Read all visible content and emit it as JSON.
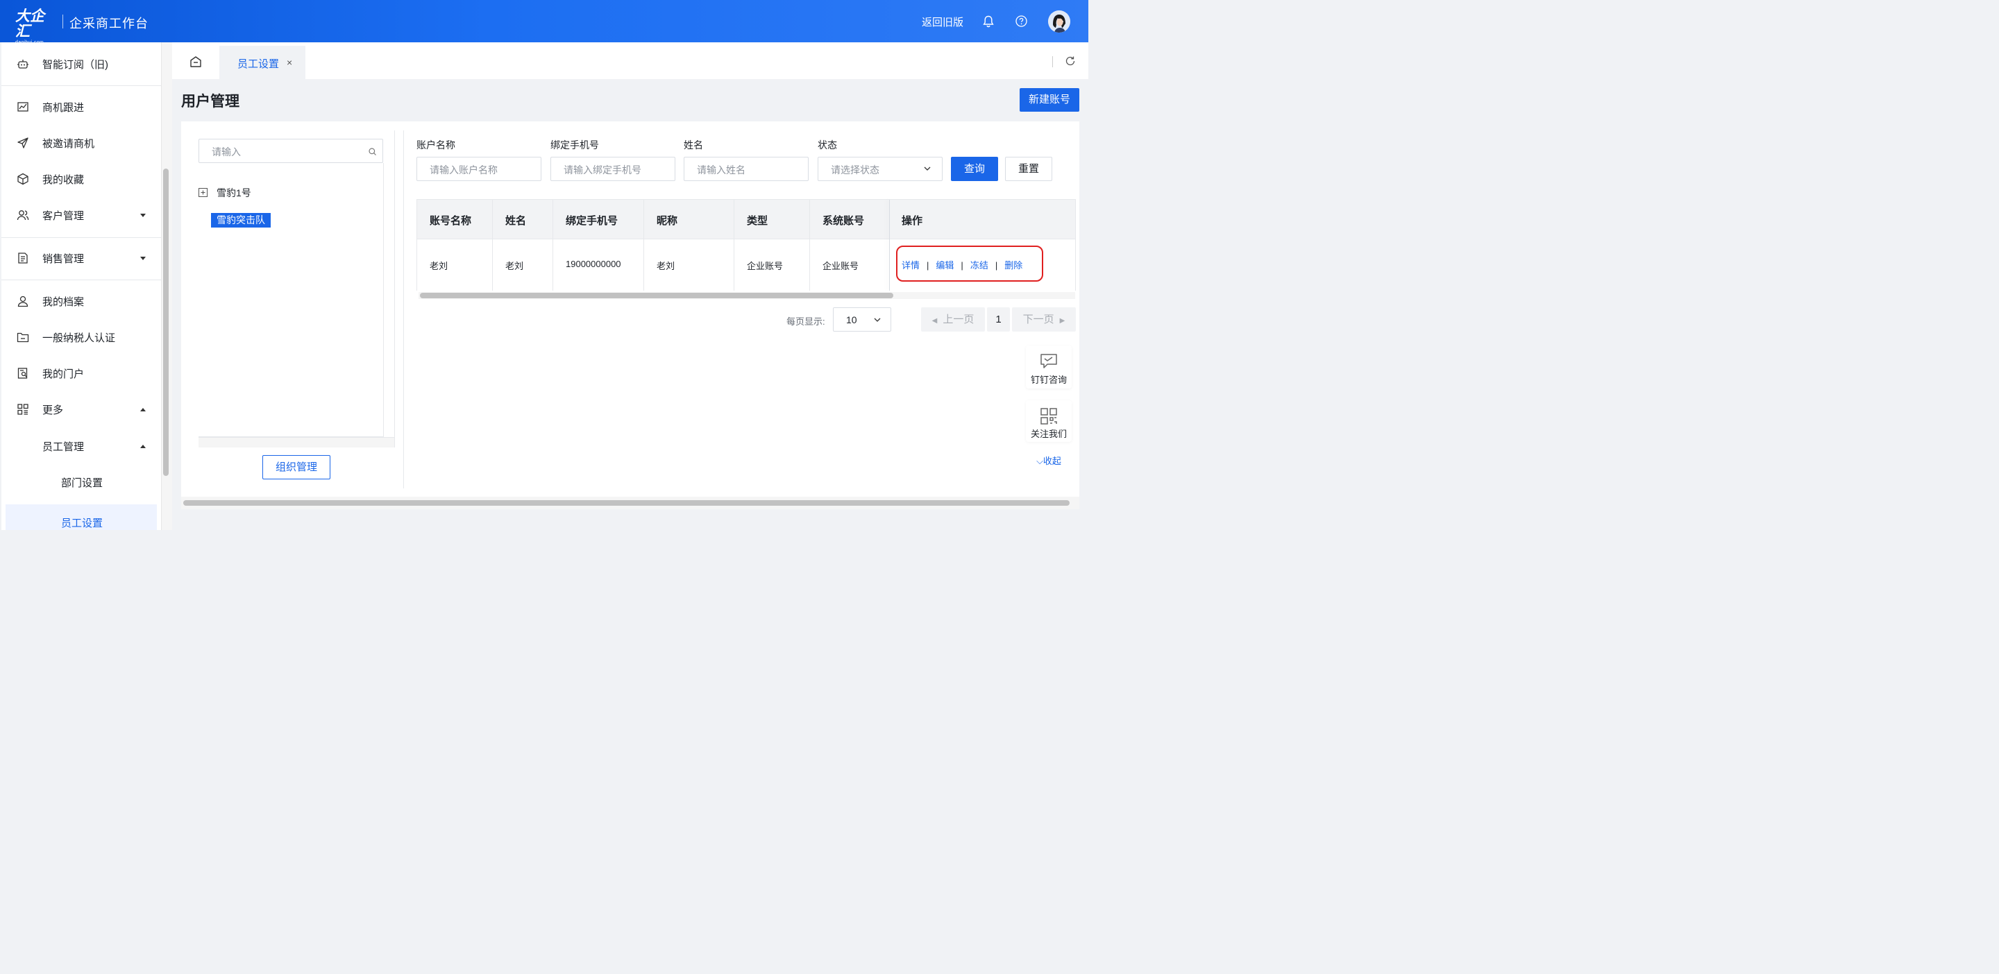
{
  "header": {
    "logo_main": "大企汇",
    "logo_sub": "daqihui.com",
    "app_title": "企采商工作台",
    "old_version_link": "返回旧版"
  },
  "sidebar": {
    "items": [
      {
        "label": "智能订阅（旧)",
        "icon": "robot-icon"
      },
      {
        "label": "商机跟进",
        "icon": "chart-icon"
      },
      {
        "label": "被邀请商机",
        "icon": "send-icon"
      },
      {
        "label": "我的收藏",
        "icon": "box-icon"
      },
      {
        "label": "客户管理",
        "icon": "users-icon"
      },
      {
        "label": "销售管理",
        "icon": "document-icon"
      },
      {
        "label": "我的档案",
        "icon": "user-icon"
      },
      {
        "label": "一般纳税人认证",
        "icon": "folder-icon"
      },
      {
        "label": "我的门户",
        "icon": "portal-icon"
      },
      {
        "label": "更多",
        "icon": "grid-icon"
      },
      {
        "label": "员工管理"
      },
      {
        "label": "部门设置"
      },
      {
        "label": "员工设置"
      }
    ]
  },
  "tabs": {
    "active_tab": "员工设置",
    "close_glyph": "×"
  },
  "page": {
    "title": "用户管理",
    "new_account_button": "新建账号"
  },
  "tree": {
    "search_placeholder": "请输入",
    "nodes": [
      {
        "label": "雪豹1号"
      },
      {
        "label": "雪豹突击队"
      }
    ],
    "org_button": "组织管理"
  },
  "filters": {
    "account_name": {
      "label": "账户名称",
      "placeholder": "请输入账户名称"
    },
    "phone": {
      "label": "绑定手机号",
      "placeholder": "请输入绑定手机号"
    },
    "name": {
      "label": "姓名",
      "placeholder": "请输入姓名"
    },
    "status": {
      "label": "状态",
      "placeholder": "请选择状态"
    },
    "query_button": "查询",
    "reset_button": "重置"
  },
  "table": {
    "columns": [
      "账号名称",
      "姓名",
      "绑定手机号",
      "昵称",
      "类型",
      "系统账号",
      "操作"
    ],
    "rows": [
      {
        "account_name": "老刘",
        "name": "老刘",
        "phone": "19000000000",
        "nickname": "老刘",
        "type": "企业账号",
        "system_account": "企业账号",
        "actions": [
          "详情",
          "编辑",
          "冻结",
          "删除"
        ]
      }
    ],
    "action_separator": "|"
  },
  "pagination": {
    "page_size_label": "每页显示:",
    "page_size": "10",
    "prev": "上一页",
    "current_page": "1",
    "next": "下一页"
  },
  "float_panel": {
    "dingtalk": "钉钉咨询",
    "follow": "关注我们",
    "collapse": "收起"
  },
  "colors": {
    "primary": "#1a66e8",
    "header_gradient_start": "#0a56d8",
    "header_gradient_end": "#2f7bf5",
    "highlight_box": "#e02020"
  }
}
